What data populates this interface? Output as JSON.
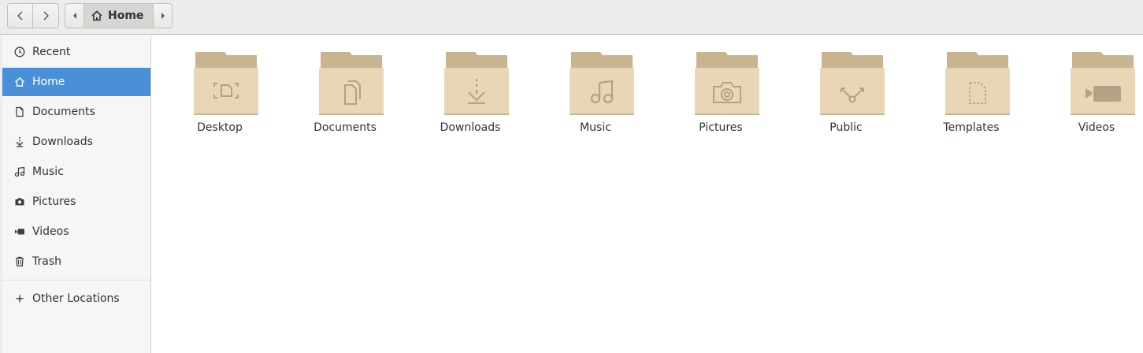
{
  "toolbar": {
    "back_icon": "chevron-left-icon",
    "forward_icon": "chevron-right-icon",
    "path": {
      "current": "Home",
      "icon": "home-icon"
    }
  },
  "sidebar": {
    "items": [
      {
        "label": "Recent",
        "icon": "clock-icon"
      },
      {
        "label": "Home",
        "icon": "home-icon",
        "active": true
      },
      {
        "label": "Documents",
        "icon": "document-icon"
      },
      {
        "label": "Downloads",
        "icon": "download-icon"
      },
      {
        "label": "Music",
        "icon": "music-icon"
      },
      {
        "label": "Pictures",
        "icon": "camera-icon"
      },
      {
        "label": "Videos",
        "icon": "video-icon"
      },
      {
        "label": "Trash",
        "icon": "trash-icon"
      }
    ],
    "other_locations": {
      "label": "Other Locations",
      "icon": "plus-icon"
    }
  },
  "folders": [
    {
      "label": "Desktop",
      "emblem": "desktop-icon"
    },
    {
      "label": "Documents",
      "emblem": "document-icon"
    },
    {
      "label": "Downloads",
      "emblem": "download-icon"
    },
    {
      "label": "Music",
      "emblem": "music-icon"
    },
    {
      "label": "Pictures",
      "emblem": "camera-icon"
    },
    {
      "label": "Public",
      "emblem": "share-icon"
    },
    {
      "label": "Templates",
      "emblem": "template-icon"
    },
    {
      "label": "Videos",
      "emblem": "video-icon"
    }
  ],
  "colors": {
    "accent": "#4a90d9",
    "folder_body": "#e8d6b6",
    "folder_tab": "#c8b48e",
    "folder_emblem": "#b3a285"
  }
}
